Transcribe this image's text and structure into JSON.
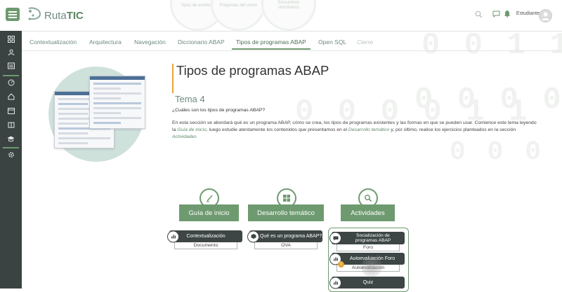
{
  "header": {
    "logo_prefix": "Ruta",
    "logo_suffix": "TIC",
    "ghost_circles": [
      "Tipos de archivos",
      "Preguntas del curso",
      "Encuentros sincrónicos"
    ],
    "user_name": "Estudiante",
    "icons": [
      "search-icon",
      "chat-icon",
      "bell-icon"
    ]
  },
  "sidebar": {
    "items": [
      "dashboard-icon",
      "users-icon",
      "news-icon",
      "gauge-icon",
      "home-icon",
      "calendar-icon",
      "library-icon",
      "graduation-cap-icon",
      "settings-icon"
    ]
  },
  "tabs": [
    {
      "label": "Contextualización"
    },
    {
      "label": "Arquitectura"
    },
    {
      "label": "Navegación"
    },
    {
      "label": "Diccionario ABAP"
    },
    {
      "label": "Tipos de programas ABAP",
      "active": true
    },
    {
      "label": "Open SQL"
    },
    {
      "label": "Cierre",
      "disabled": true
    }
  ],
  "main": {
    "title": "Tipos de programas ABAP",
    "subtitle": "Tema 4",
    "question": "¿Cuáles son los tipos de programas ABAP?",
    "body": {
      "p1": "En esta sección se abordará qué es un programa ABAP, cómo se crea, los tipos de programas existentes y las formas en que se pueden usar. Comience este tema leyendo la ",
      "link1": "Guía de inicio",
      "p2": ", luego estudie atentamente los contenidos que presentamos en el ",
      "link2": "Desarrollo temático",
      "p3": " y, por último, realice los ejercicios planteados en la sección ",
      "link3": "Actividades"
    }
  },
  "sections": [
    {
      "label": "Guía de inicio",
      "icon": "pencil-icon"
    },
    {
      "label": "Desarrollo temático",
      "icon": "puzzle-icon"
    },
    {
      "label": "Actividades",
      "icon": "magnifier-icon"
    }
  ],
  "cards": {
    "guia": [
      {
        "title": "Contextualización",
        "sub": "Documento",
        "icon": "chart-icon"
      }
    ],
    "desarrollo": [
      {
        "title": "¿Qué es un programa ABAP?",
        "sub": "OVA",
        "icon": "cube-icon"
      }
    ],
    "actividades": [
      {
        "title": "Socialización de programas ABAP",
        "sub": "Foro",
        "icon": "speech-icon"
      },
      {
        "title": "Autoevaluación Foro",
        "sub": "Autoevaluación",
        "icon": "chart-icon"
      },
      {
        "title": "Quiz",
        "sub": "",
        "icon": "chart-icon"
      }
    ]
  },
  "colors": {
    "accent": "#6e9a6f",
    "sidebar": "#3b4242",
    "title_bar": "#e8a43b",
    "hero": "#cfe1db",
    "card": "#3d4545"
  }
}
